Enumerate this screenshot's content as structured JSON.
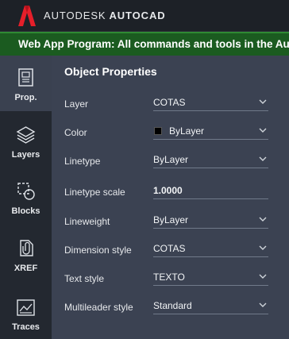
{
  "app": {
    "brand_part1": "AUTODESK",
    "brand_part2": "AUTOCAD",
    "logo_icon": "autocad-a-logo-icon",
    "logo_color": "#e51f2a"
  },
  "banner": {
    "text": "Web App Program: All commands and tools in the Au",
    "bg_color": "#1b5b20"
  },
  "sidebar": {
    "items": [
      {
        "label": "Prop.",
        "icon": "properties-icon",
        "active": true
      },
      {
        "label": "Layers",
        "icon": "layers-icon",
        "active": false
      },
      {
        "label": "Blocks",
        "icon": "blocks-icon",
        "active": false
      },
      {
        "label": "XREF",
        "icon": "xref-icon",
        "active": false
      },
      {
        "label": "Traces",
        "icon": "traces-icon",
        "active": false
      }
    ]
  },
  "panel": {
    "title": "Object Properties",
    "rows": [
      {
        "label": "Layer",
        "value": "COTAS",
        "dropdown": true
      },
      {
        "label": "Color",
        "value": "ByLayer",
        "dropdown": true,
        "swatch": "#000000"
      },
      {
        "label": "Linetype",
        "value": "ByLayer",
        "dropdown": true
      },
      {
        "label": "Linetype scale",
        "value": "1.0000",
        "dropdown": false
      },
      {
        "label": "Lineweight",
        "value": "ByLayer",
        "dropdown": true
      },
      {
        "label": "Dimension style",
        "value": "COTAS",
        "dropdown": true
      },
      {
        "label": "Text style",
        "value": "TEXTO",
        "dropdown": true
      },
      {
        "label": "Multileader style",
        "value": "Standard",
        "dropdown": true
      }
    ]
  }
}
